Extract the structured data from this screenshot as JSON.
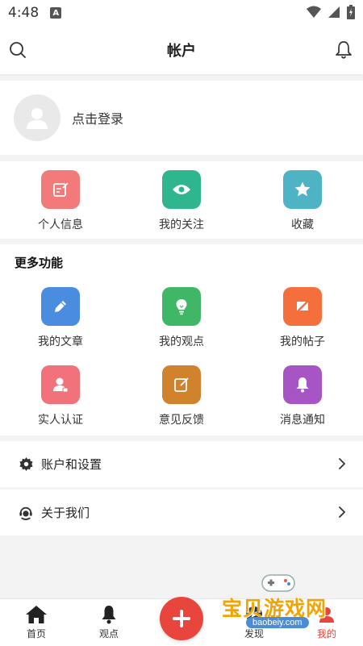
{
  "status_bar": {
    "time": "4:48",
    "notification_badge": "A"
  },
  "header": {
    "title": "帐户"
  },
  "login": {
    "prompt": "点击登录"
  },
  "quick_actions": [
    {
      "label": "个人信息",
      "icon": "edit-note-icon",
      "color": "#f27a7a"
    },
    {
      "label": "我的关注",
      "icon": "eye-icon",
      "color": "#2fb68e"
    },
    {
      "label": "收藏",
      "icon": "star-icon",
      "color": "#4fb3c6"
    }
  ],
  "more_features": {
    "title": "更多功能",
    "rows": [
      [
        {
          "label": "我的文章",
          "icon": "pencil-icon",
          "color": "#4a8de0"
        },
        {
          "label": "我的观点",
          "icon": "lightbulb-icon",
          "color": "#3fb767"
        },
        {
          "label": "我的帖子",
          "icon": "no-post-icon",
          "color": "#f56f3c"
        }
      ],
      [
        {
          "label": "实人认证",
          "icon": "id-verify-icon",
          "color": "#f1727a"
        },
        {
          "label": "意见反馈",
          "icon": "feedback-icon",
          "color": "#d1822d"
        },
        {
          "label": "消息通知",
          "icon": "bell-icon",
          "color": "#a755c4"
        }
      ]
    ]
  },
  "menu": [
    {
      "label": "账户和设置",
      "icon": "gear-icon"
    },
    {
      "label": "关于我们",
      "icon": "support-icon"
    }
  ],
  "tabbar": {
    "tabs": [
      {
        "label": "首页",
        "icon": "home-icon"
      },
      {
        "label": "观点",
        "icon": "bell-icon"
      },
      {
        "label": "",
        "icon": "plus-icon"
      },
      {
        "label": "发现",
        "icon": "discover-icon"
      },
      {
        "label": "我的",
        "icon": "profile-icon"
      }
    ]
  },
  "watermark": {
    "text": "宝贝游戏网",
    "url": "baobeiy.com"
  }
}
